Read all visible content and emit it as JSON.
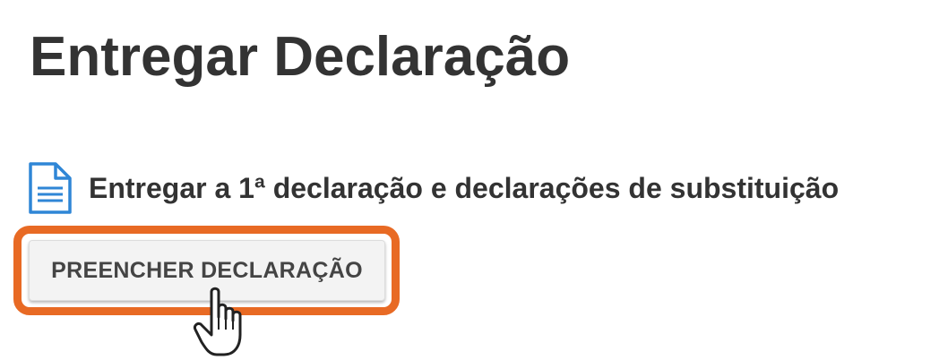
{
  "header": {
    "title": "Entregar Declaração"
  },
  "section": {
    "icon": "document-icon",
    "label": "Entregar a 1ª declaração e declarações de substituição"
  },
  "actions": {
    "fill_button_label": "PREENCHER DECLARAÇÃO"
  },
  "cursor": {
    "icon": "hand-pointer-icon"
  },
  "colors": {
    "accent_highlight": "#e86a24",
    "icon_blue": "#2f86d6",
    "text": "#333333",
    "button_bg": "#f3f3f3",
    "next_icon_teal": "#3aa7a3"
  }
}
